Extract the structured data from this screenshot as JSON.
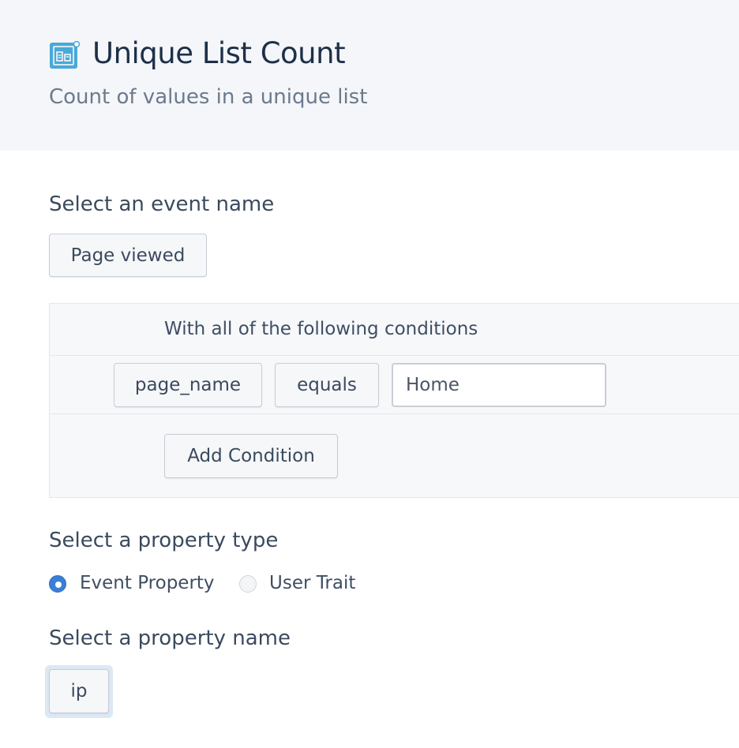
{
  "header": {
    "title": "Unique List Count",
    "subtitle": "Count of values in a unique list",
    "icon": "unique-list-icon",
    "icon_color": "#4aa8d8"
  },
  "event_section": {
    "label": "Select an event name",
    "selected_event": "Page viewed"
  },
  "conditions": {
    "header": "With all of the following conditions",
    "rows": [
      {
        "property": "page_name",
        "operator": "equals",
        "value": "Home"
      }
    ],
    "add_label": "Add Condition"
  },
  "property_type": {
    "label": "Select a property type",
    "options": [
      {
        "label": "Event Property",
        "checked": true
      },
      {
        "label": "User Trait",
        "checked": false
      }
    ],
    "accent": "#3a7fd5"
  },
  "property_name": {
    "label": "Select a property name",
    "selected": "ip"
  }
}
